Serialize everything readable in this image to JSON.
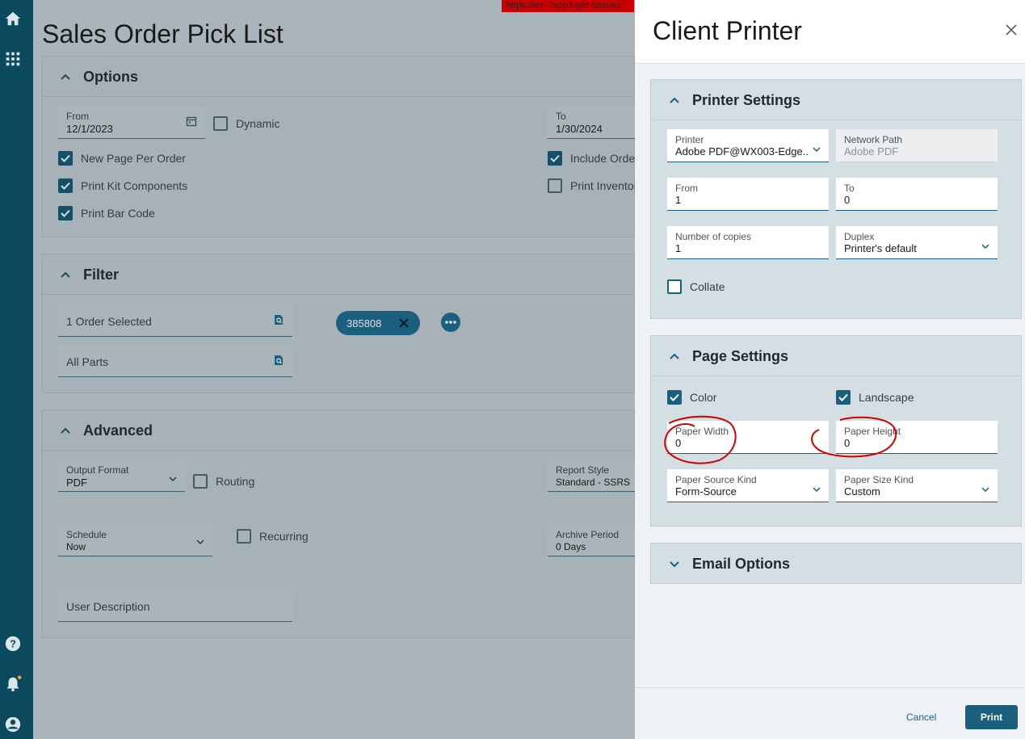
{
  "app": {
    "url": "https://ep10app3.gikt.com/ep1",
    "page_title": "Sales Order Pick List"
  },
  "colors": {
    "rail": "#0b4a5e",
    "accent": "#1b5f7f",
    "url_banner": "#cc0000",
    "annotation": "#d40000"
  },
  "rail": {
    "icons": [
      "home-icon",
      "apps-grid-icon",
      "help-icon",
      "notifications-bell-icon",
      "user-profile-icon"
    ]
  },
  "options": {
    "title": "Options",
    "from_label": "From",
    "from_value": "12/1/2023",
    "dynamic_label": "Dynamic",
    "to_label": "To",
    "to_value": "1/30/2024",
    "new_page_per_order": "New Page Per Order",
    "include_order": "Include Order",
    "print_kit_components": "Print Kit Components",
    "print_inventory": "Print Inventor",
    "print_bar_code": "Print Bar Code"
  },
  "filter": {
    "title": "Filter",
    "order_field": "1 Order Selected",
    "parts_field": "All Parts",
    "chip": "385808"
  },
  "advanced": {
    "title": "Advanced",
    "output_format_label": "Output Format",
    "output_format_value": "PDF",
    "routing_label": "Routing",
    "report_style_label": "Report Style",
    "report_style_value": "Standard - SSRS",
    "schedule_label": "Schedule",
    "schedule_value": "Now",
    "recurring_label": "Recurring",
    "archive_period_label": "Archive Period",
    "archive_period_value": "0 Days",
    "user_description_placeholder": "User Description"
  },
  "drawer": {
    "title": "Client Printer",
    "printer_settings": {
      "title": "Printer Settings",
      "printer_label": "Printer",
      "printer_value": "Adobe PDF@WX003-Edge...",
      "network_path_label": "Network Path",
      "network_path_value": "Adobe PDF",
      "from_label": "From",
      "from_value": "1",
      "to_label": "To",
      "to_value": "0",
      "copies_label": "Number of copies",
      "copies_value": "1",
      "duplex_label": "Duplex",
      "duplex_value": "Printer's default",
      "collate_label": "Collate"
    },
    "page_settings": {
      "title": "Page Settings",
      "color_label": "Color",
      "landscape_label": "Landscape",
      "paper_width_label": "Paper Width",
      "paper_width_value": "0",
      "paper_height_label": "Paper Height",
      "paper_height_value": "0",
      "paper_source_label": "Paper Source Kind",
      "paper_source_value": "Form-Source",
      "paper_size_label": "Paper Size Kind",
      "paper_size_value": "Custom"
    },
    "email_options": {
      "title": "Email Options"
    },
    "cancel_label": "Cancel",
    "print_label": "Print"
  }
}
